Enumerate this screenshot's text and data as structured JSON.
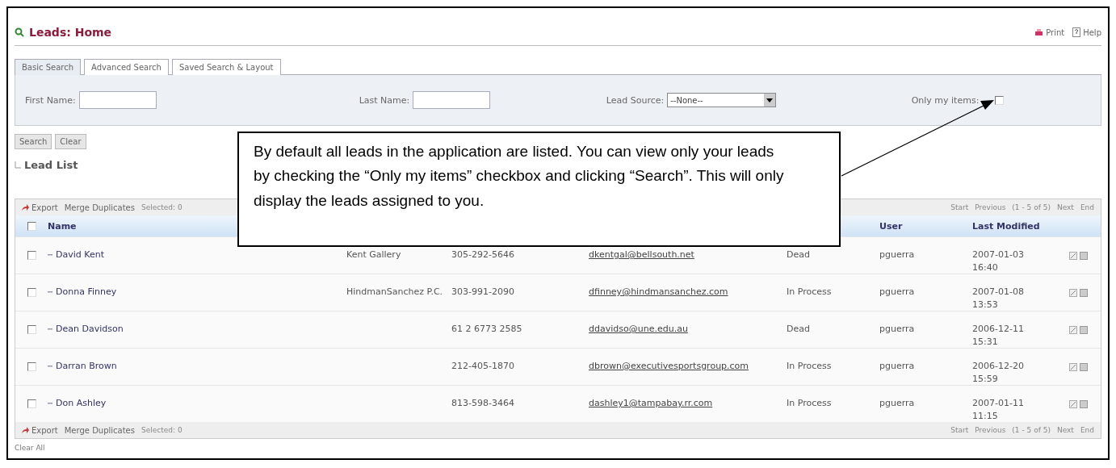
{
  "header": {
    "title": "Leads: Home",
    "links": [
      {
        "kind": "print",
        "label": "Print"
      },
      {
        "kind": "help",
        "label": "Help"
      }
    ]
  },
  "tabs": [
    {
      "label": "Basic Search",
      "selected": true
    },
    {
      "label": "Advanced Search",
      "selected": false
    },
    {
      "label": "Saved Search & Layout",
      "selected": false
    }
  ],
  "search": {
    "first_name_label": "First Name:",
    "last_name_label": "Last Name:",
    "lead_source_label": "Lead Source:",
    "lead_source_value": "--None--",
    "only_my_items_label": "Only my items:",
    "only_my_items_checked": false
  },
  "buttons": [
    "Search",
    "Clear"
  ],
  "list_title": "Lead List",
  "toolbars": [
    {
      "export": "Export",
      "merge": "Merge Duplicates",
      "selected": "Selected: 0",
      "pager": [
        "Start",
        "Previous",
        "(1 - 5 of 5)",
        "Next",
        "End"
      ]
    },
    {
      "export": "Export",
      "merge": "Merge Duplicates",
      "selected": "Selected: 0",
      "pager": [
        "Start",
        "Previous",
        "(1 - 5 of 5)",
        "Next",
        "End"
      ]
    }
  ],
  "select_all_checked": false,
  "columns": {
    "name": "Name",
    "user": "User",
    "last_modified": "Last Modified"
  },
  "rows": [
    {
      "checked": false,
      "name": "David Kent",
      "column_3": "Kent Gallery",
      "column_4": "305-292-5646",
      "column_5": "dkentgal@bellsouth.net",
      "column_6": "Dead",
      "user": "pguerra",
      "last_modified": "2007-01-03 16:40"
    },
    {
      "checked": false,
      "name": "Donna Finney",
      "column_3": "HindmanSanchez P.C.",
      "column_4": "303-991-2090",
      "column_5": "dfinney@hindmansanchez.com",
      "column_6": "In Process",
      "user": "pguerra",
      "last_modified": "2007-01-08 13:53"
    },
    {
      "checked": false,
      "name": "Dean Davidson",
      "column_4": "61 2 6773 2585",
      "column_5": "ddavidso@une.edu.au",
      "column_6": "Dead",
      "user": "pguerra",
      "last_modified": "2006-12-11 15:31"
    },
    {
      "checked": false,
      "name": "Darran Brown",
      "column_4": "212-405-1870",
      "column_5": "dbrown@executivesportsgroup.com",
      "column_6": "In Process",
      "user": "pguerra",
      "last_modified": "2006-12-20 15:59"
    },
    {
      "checked": false,
      "name": "Don Ashley",
      "column_4": "813-598-3464",
      "column_5": "dashley1@tampabay.rr.com",
      "column_6": "In Process",
      "user": "pguerra",
      "last_modified": "2007-01-11 11:15"
    }
  ],
  "clear_all": "Clear All",
  "callout": "By default all leads in the application are listed. You can view only your leads by checking the “Only my items” checkbox and clicking “Search”. This will only display the leads assigned to you."
}
